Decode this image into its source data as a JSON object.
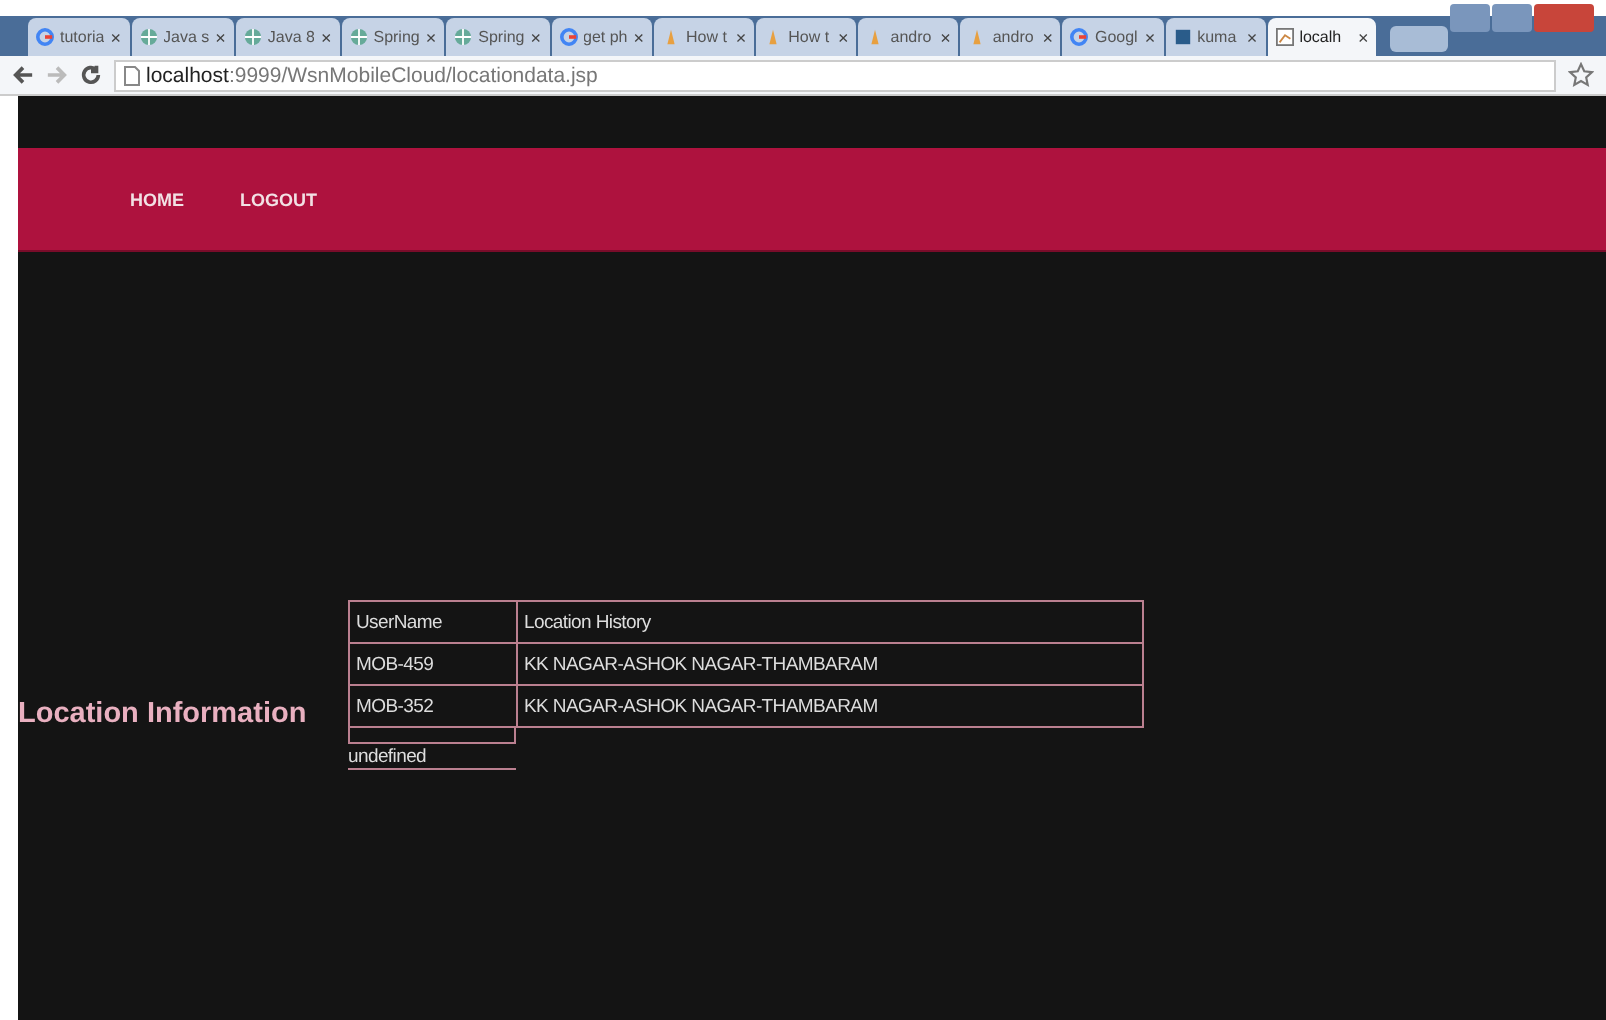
{
  "browser": {
    "tabs": [
      {
        "label": "tutoria",
        "kind": "google",
        "selected": false
      },
      {
        "label": "Java s",
        "kind": "globe",
        "selected": false
      },
      {
        "label": "Java 8",
        "kind": "globe",
        "selected": false
      },
      {
        "label": "Spring",
        "kind": "globe",
        "selected": false
      },
      {
        "label": "Spring",
        "kind": "globe",
        "selected": false
      },
      {
        "label": "get ph",
        "kind": "google",
        "selected": false
      },
      {
        "label": "How t",
        "kind": "figure",
        "selected": false
      },
      {
        "label": "How t",
        "kind": "figure",
        "selected": false
      },
      {
        "label": "andro",
        "kind": "figure",
        "selected": false
      },
      {
        "label": "andro",
        "kind": "figure",
        "selected": false
      },
      {
        "label": "Googl",
        "kind": "google",
        "selected": false
      },
      {
        "label": "kuma",
        "kind": "page",
        "selected": false
      },
      {
        "label": "localh",
        "kind": "chart",
        "selected": true
      }
    ],
    "close_glyph": "×",
    "address": {
      "host": "localhost",
      "rest": ":9999/WsnMobileCloud/locationdata.jsp"
    }
  },
  "nav": [
    {
      "label": "HOME"
    },
    {
      "label": "LOGOUT"
    }
  ],
  "heading": "Location Information",
  "table": {
    "columns": [
      "UserName",
      "Location History"
    ],
    "rows": [
      [
        "MOB-459",
        "KK NAGAR-ASHOK NAGAR-THAMBARAM"
      ],
      [
        "MOB-352",
        "KK NAGAR-ASHOK NAGAR-THAMBARAM"
      ]
    ]
  },
  "footer_text": "undefined"
}
